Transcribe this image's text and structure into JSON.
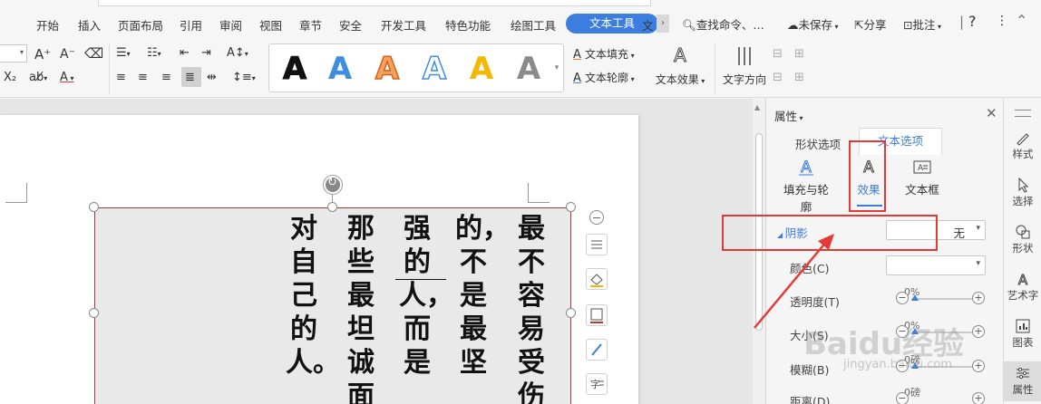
{
  "menu": {
    "items": [
      "开始",
      "插入",
      "页面布局",
      "引用",
      "审阅",
      "视图",
      "章节",
      "安全",
      "开发工具",
      "特色功能",
      "绘图工具"
    ],
    "active": "文本工具",
    "partial": "文",
    "search": "查找命令、…",
    "unsaved": "未保存",
    "share": "分享",
    "comment": "批注",
    "help": "?"
  },
  "ribbon": {
    "fill_label": "文本填充",
    "outline_label": "文本轮廓",
    "effect_label": "文本效果",
    "direction_label": "文字方向",
    "styles": [
      {
        "glyph": "A",
        "color": "#111111",
        "stroke": "#111111"
      },
      {
        "glyph": "A",
        "color": "#3f8de0",
        "stroke": "#3f8de0"
      },
      {
        "glyph": "A",
        "color": "#f08a3c",
        "stroke": "#c0601d"
      },
      {
        "glyph": "A",
        "color": "#ffffff",
        "stroke": "#3f8de0"
      },
      {
        "glyph": "A",
        "color": "#f5b800",
        "stroke": "#f5b800"
      },
      {
        "glyph": "A",
        "color": "#7b7b7b",
        "stroke": "#7b7b7b"
      }
    ]
  },
  "document": {
    "columns": [
      "最不容易受伤",
      "的，不是最坚",
      "强的人，而是",
      "那些最坦诚面",
      "对自己的人。"
    ]
  },
  "panel": {
    "title": "属性",
    "tabs": [
      "形状选项",
      "文本选项"
    ],
    "subtabs": [
      "填充与轮廓",
      "效果",
      "文本框"
    ],
    "shadow_label": "阴影",
    "shadow_value": "无",
    "color_label": "颜色(C)",
    "transparency_label": "透明度(T)",
    "transparency_value": "0%",
    "size_label": "大小(S)",
    "size_value": "0%",
    "blur_label": "模糊(B)",
    "blur_value": "0磅",
    "distance_label": "距离(D)",
    "distance_value": "0磅"
  },
  "sidebar": {
    "items": [
      "样式",
      "选择",
      "形状",
      "艺术字",
      "图表",
      "属性"
    ]
  },
  "watermark": {
    "brand": "Baidu经验",
    "url": "jingyan.baidu.com"
  },
  "colors": {
    "accent": "#3c7de0",
    "annotation": "#e53935"
  }
}
